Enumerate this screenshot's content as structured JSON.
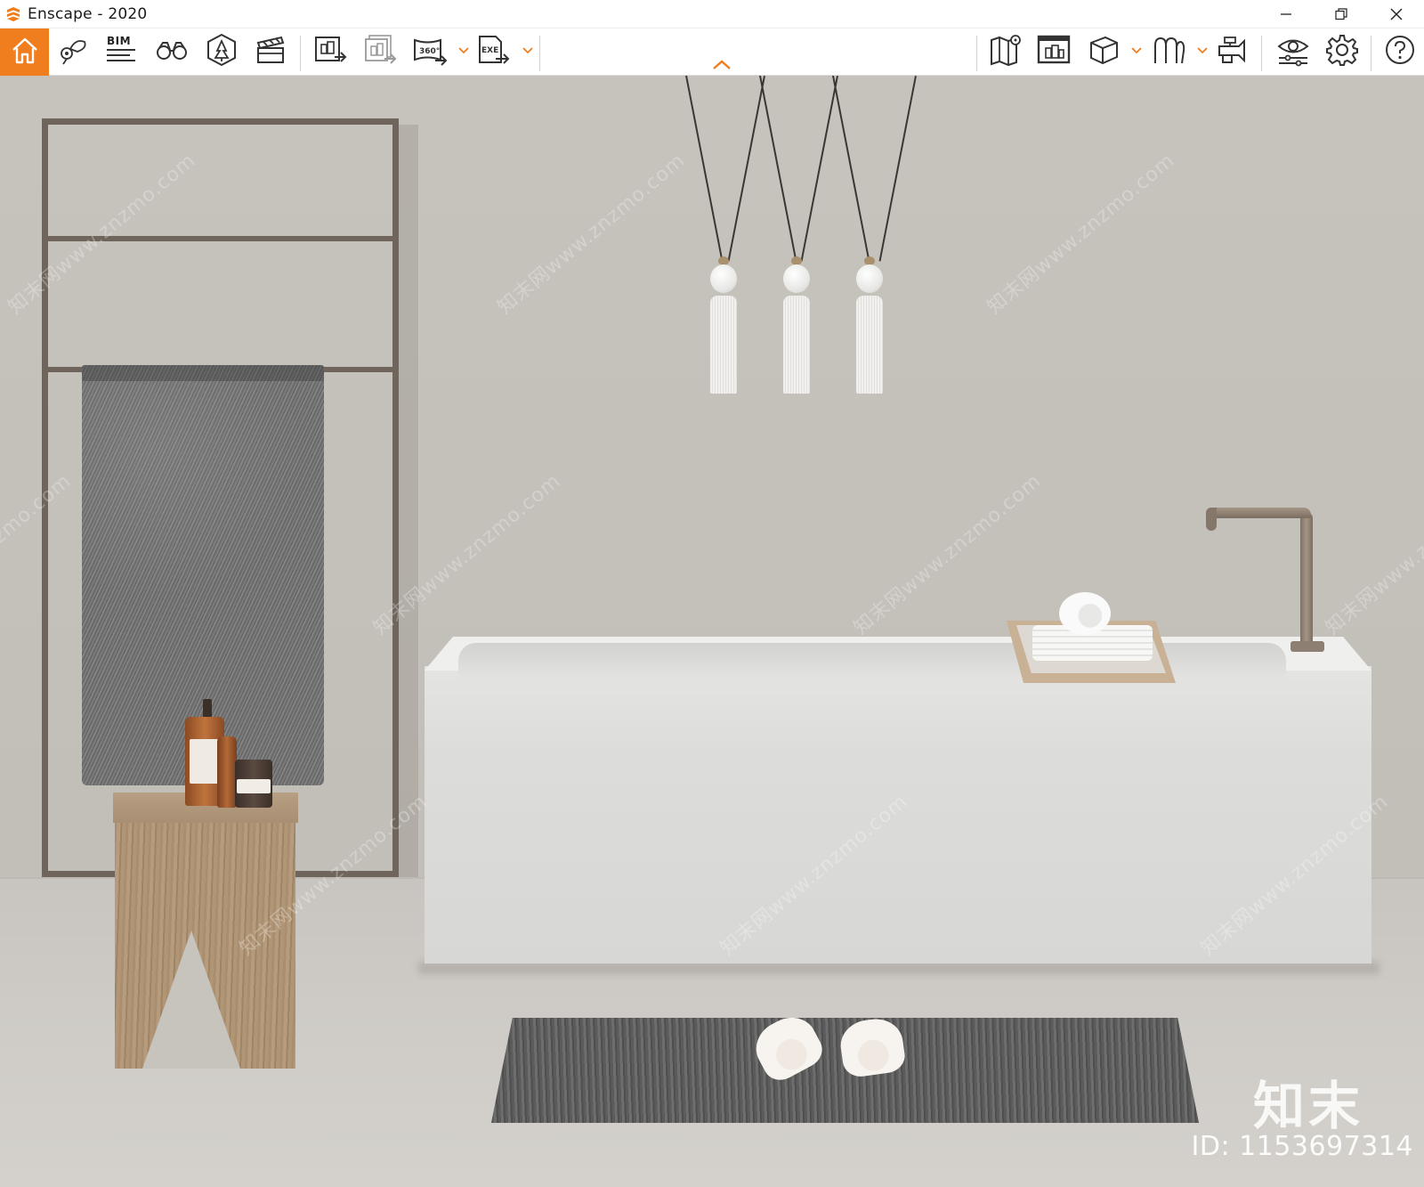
{
  "window": {
    "title": "Enscape - 2020",
    "controls": [
      "minimize",
      "restore",
      "close"
    ]
  },
  "toolbar": {
    "bim_label": "BIM",
    "left_group": [
      {
        "name": "home-icon",
        "active": true
      },
      {
        "name": "views-icon"
      },
      {
        "name": "bim-icon"
      },
      {
        "name": "binoculars-icon"
      },
      {
        "name": "asset-library-icon"
      },
      {
        "name": "video-editor-icon"
      }
    ],
    "export_group": [
      {
        "name": "render-image-icon"
      },
      {
        "name": "batch-render-icon"
      },
      {
        "name": "panorama-360-icon"
      },
      {
        "name": "export-exe-icon"
      }
    ],
    "right_group": [
      {
        "name": "map-icon"
      },
      {
        "name": "web-standalone-icon"
      },
      {
        "name": "section-box-icon"
      },
      {
        "name": "vr-headset-icon"
      },
      {
        "name": "feedback-icon"
      },
      {
        "name": "visual-settings-icon"
      },
      {
        "name": "general-settings-icon"
      },
      {
        "name": "help-icon"
      }
    ],
    "accent_color": "#f07d1e"
  },
  "viewport": {
    "watermark_text": "知末网www.znzmo.com",
    "brand_mark": "知末",
    "id_label": "ID: 1153697314"
  }
}
